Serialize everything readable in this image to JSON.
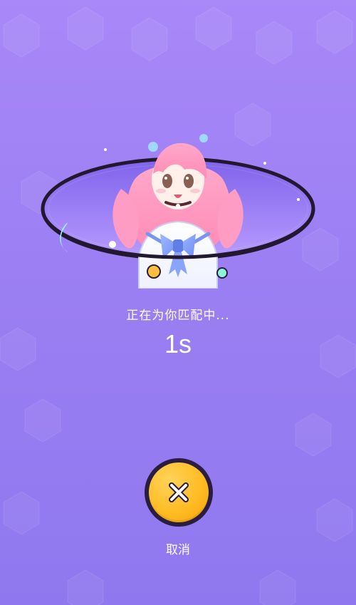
{
  "matching": {
    "status_text": "正在为你匹配中...",
    "timer_text": "1s"
  },
  "cancel": {
    "label": "取消"
  },
  "colors": {
    "background_top": "#a988f8",
    "background_bottom": "#8f78ef",
    "button_fill": "#ffbc24",
    "button_border": "#2a1d3f",
    "ring_border": "#22182f",
    "ring_fill": "#9b7cf2"
  }
}
